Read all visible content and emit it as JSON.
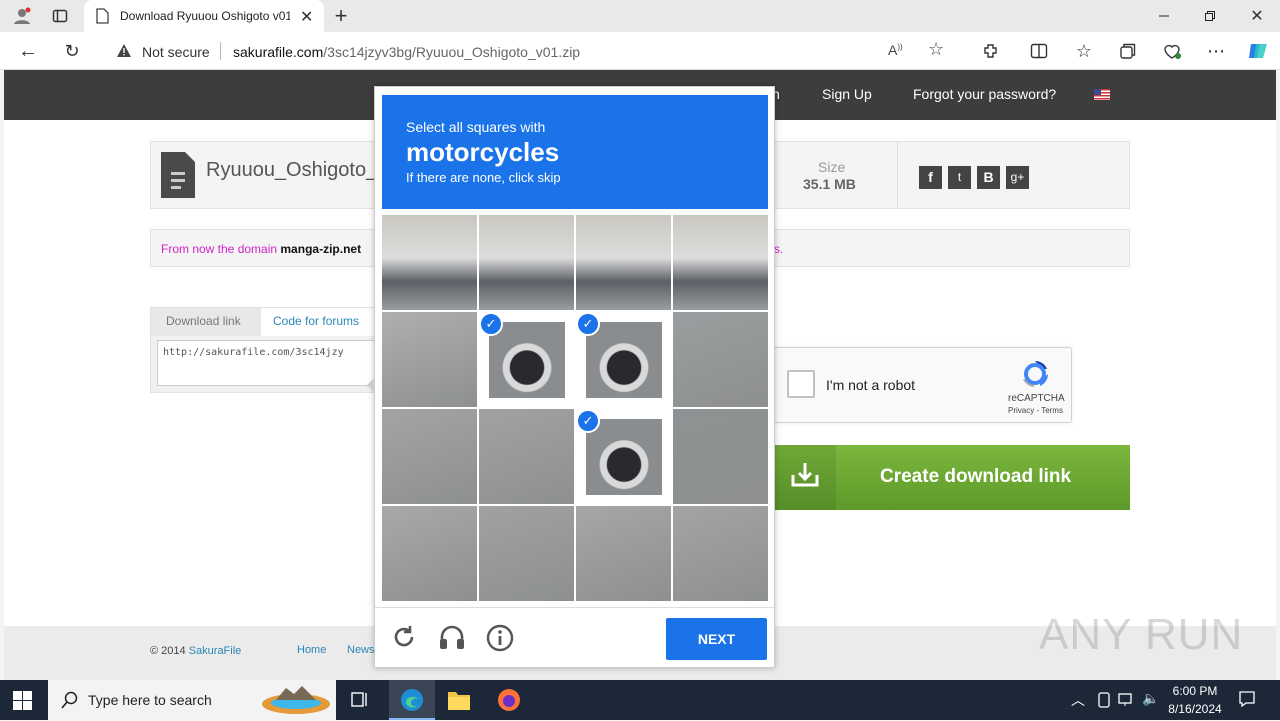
{
  "browser": {
    "tab_title": "Download Ryuuou Oshigoto v01",
    "security_label": "Not secure",
    "url_domain": "sakurafile.com",
    "url_path": "/3sc14jzyv3bg/Ryuuou_Oshigoto_v01.zip"
  },
  "site": {
    "header_links": [
      "n",
      "Sign Up",
      "Forgot your password?"
    ],
    "file_name": "Ryuuou_Oshigoto_v",
    "size_label": "Size",
    "size_value": "35.1 MB",
    "social": [
      "f",
      "t",
      "B",
      "g+"
    ],
    "notice_pre": "From now the domain ",
    "notice_domain": "manga-zip.net",
    "notice_post": "rks.",
    "tab_download": "Download link",
    "tab_forums": "Code for forums",
    "download_url": "http://sakurafile.com/3sc14jzy",
    "not_robot": "I'm not a robot",
    "recaptcha_brand": "reCAPTCHA",
    "recaptcha_links": "Privacy - Terms",
    "create_button": "Create download link",
    "footer_copy": "© 2014 ",
    "footer_brand": "SakuraFile",
    "footer_links": [
      "Home",
      "News"
    ]
  },
  "captcha": {
    "instruction": "Select all squares with",
    "target": "motorcycles",
    "hint": "If there are none, click skip",
    "next_label": "NEXT",
    "selected_cells": [
      5,
      6,
      10
    ]
  },
  "taskbar": {
    "search_placeholder": "Type here to search",
    "time": "6:00 PM",
    "date": "8/16/2024"
  },
  "watermark": "ANY RUN"
}
